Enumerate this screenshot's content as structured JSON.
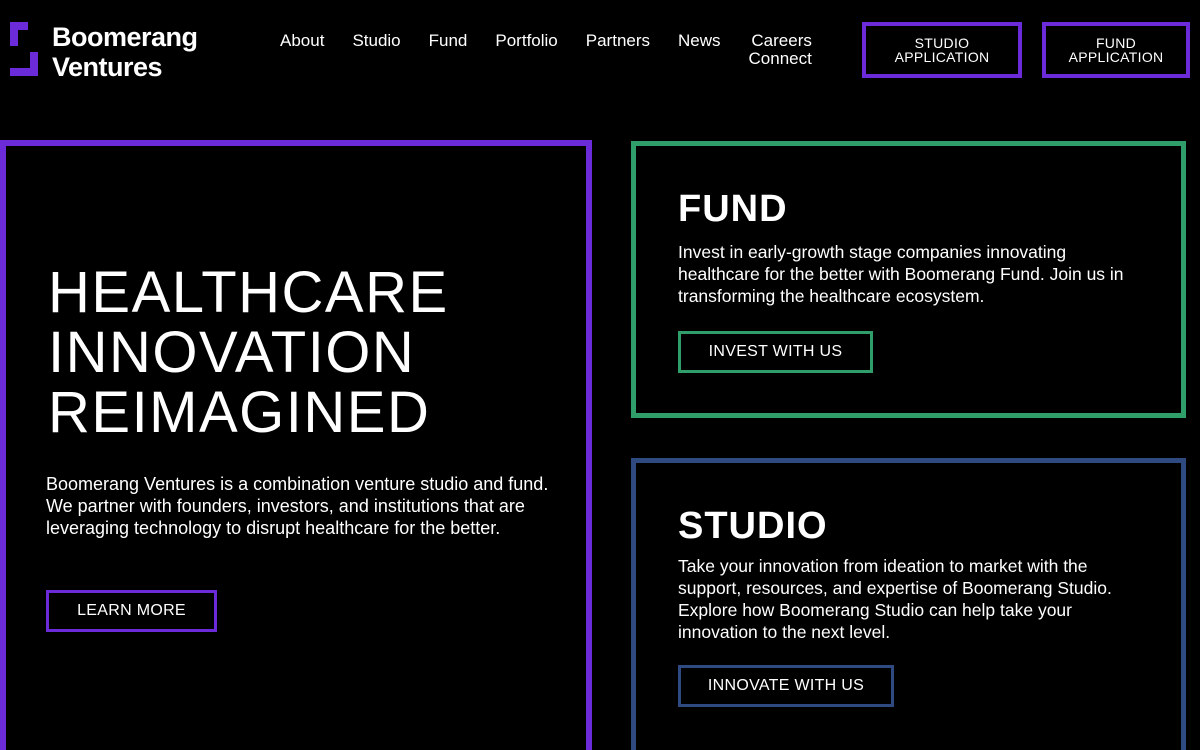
{
  "brand": {
    "line1": "Boomerang",
    "line2": "Ventures",
    "accent_color": "#6c2bd9"
  },
  "nav": {
    "items": [
      "About",
      "Studio",
      "Fund",
      "Portfolio",
      "Partners",
      "News"
    ],
    "careers_line1": "Careers",
    "careers_line2": "Connect"
  },
  "header_ctas": {
    "studio_line1": "STUDIO",
    "studio_line2": "APPLICATION",
    "fund_line1": "FUND",
    "fund_line2": "APPLICATION"
  },
  "hero": {
    "title_lines": [
      "HEALTHCARE",
      "INNOVATION",
      "REIMAGINED"
    ],
    "description": "Boomerang Ventures is a combination venture studio and fund. We partner with founders, investors, and institutions that are leveraging technology to disrupt healthcare for the better.",
    "button_label": "LEARN MORE"
  },
  "fund_card": {
    "title": "FUND",
    "description": "Invest in early-growth stage companies innovating healthcare for the better with Boomerang Fund. Join us in transforming the healthcare ecosystem.",
    "button_label": "INVEST WITH US",
    "border_color": "#2f9e6b"
  },
  "studio_card": {
    "title": "STUDIO",
    "description": "Take your innovation from ideation to market with the support, resources, and expertise of Boomerang Studio. Explore how Boomerang Studio can help take your innovation to the next level.",
    "button_label": "INNOVATE WITH US",
    "border_color": "#2e4a80"
  }
}
